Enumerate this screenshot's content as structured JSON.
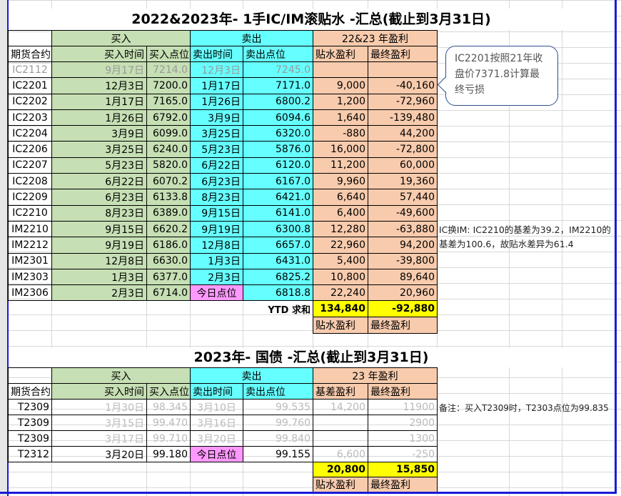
{
  "table1": {
    "title": "2022&2023年- 1手IC/IM滚贴水 -汇总(截止到3月31日)",
    "group_buy": "买入",
    "group_sell": "卖出",
    "group_profit": "22&23 年盈利",
    "headers": [
      "期货合约",
      "买入时间",
      "买入点位",
      "卖出时间",
      "卖出点位",
      "贴水盈利",
      "最终盈利"
    ],
    "rows": [
      {
        "c": "IC2112",
        "bt": "9月17日",
        "bp": "7214.0",
        "st": "12月3日",
        "sp": "7245.0",
        "dp": "",
        "fp": "",
        "gray": true
      },
      {
        "c": "IC2201",
        "bt": "12月3日",
        "bp": "7200.0",
        "st": "1月17日",
        "sp": "7171.0",
        "dp": "9,000",
        "fp": "-40,160"
      },
      {
        "c": "IC2202",
        "bt": "1月17日",
        "bp": "7165.0",
        "st": "1月26日",
        "sp": "6800.2",
        "dp": "1,200",
        "fp": "-72,960"
      },
      {
        "c": "IC2203",
        "bt": "1月26日",
        "bp": "6792.0",
        "st": "3月9日",
        "sp": "6094.6",
        "dp": "1,640",
        "fp": "-139,480"
      },
      {
        "c": "IC2204",
        "bt": "3月9日",
        "bp": "6099.0",
        "st": "3月25日",
        "sp": "6320.0",
        "dp": "-880",
        "fp": "44,200"
      },
      {
        "c": "IC2206",
        "bt": "3月25日",
        "bp": "6240.0",
        "st": "5月23日",
        "sp": "5876.0",
        "dp": "16,000",
        "fp": "-72,800"
      },
      {
        "c": "IC2207",
        "bt": "5月23日",
        "bp": "5820.0",
        "st": "6月22日",
        "sp": "6120.0",
        "dp": "11,200",
        "fp": "60,000"
      },
      {
        "c": "IC2208",
        "bt": "6月22日",
        "bp": "6070.2",
        "st": "6月23日",
        "sp": "6167.0",
        "dp": "9,960",
        "fp": "19,360"
      },
      {
        "c": "IC2209",
        "bt": "6月23日",
        "bp": "6133.8",
        "st": "8月23日",
        "sp": "6421.0",
        "dp": "6,640",
        "fp": "57,440"
      },
      {
        "c": "IC2210",
        "bt": "8月23日",
        "bp": "6389.0",
        "st": "9月15日",
        "sp": "6141.0",
        "dp": "6,400",
        "fp": "-49,600"
      },
      {
        "c": "IM2210",
        "bt": "9月15日",
        "bp": "6620.2",
        "st": "9月19日",
        "sp": "6300.8",
        "dp": "12,280",
        "fp": "-63,880"
      },
      {
        "c": "IM2212",
        "bt": "9月19日",
        "bp": "6186.0",
        "st": "12月8日",
        "sp": "6657.0",
        "dp": "22,960",
        "fp": "94,200"
      },
      {
        "c": "IM2301",
        "bt": "12月8日",
        "bp": "6630.0",
        "st": "1月3日",
        "sp": "6431.0",
        "dp": "5,400",
        "fp": "-39,800"
      },
      {
        "c": "IM2303",
        "bt": "1月3日",
        "bp": "6377.0",
        "st": "2月3日",
        "sp": "6825.2",
        "dp": "10,800",
        "fp": "89,640"
      },
      {
        "c": "IM2306",
        "bt": "2月3日",
        "bp": "6714.0",
        "st": "今日点位",
        "sp": "6818.8",
        "dp": "22,240",
        "fp": "20,960",
        "today": true
      }
    ],
    "ytd_label": "YTD 求和",
    "total_dp": "134,840",
    "total_fp": "-92,880",
    "footer": [
      "贴水盈利",
      "最终盈利"
    ]
  },
  "table2": {
    "title": "2023年- 国债 -汇总(截止到3月31日)",
    "group_buy": "买入",
    "group_sell": "卖出",
    "group_profit": "23 年盈利",
    "headers": [
      "期货合约",
      "买入时间",
      "买入点位",
      "卖出时间",
      "卖出点位",
      "基差盈利",
      "最终盈利"
    ],
    "rows": [
      {
        "c": "T2309",
        "bt": "1月30日",
        "bp": "98.345",
        "st": "3月10日",
        "sp": "99.535",
        "dp": "14,200",
        "fp": "11900",
        "gray": true
      },
      {
        "c": "T2309",
        "bt": "3月15日",
        "bp": "99.470",
        "st": "3月16日",
        "sp": "99.760",
        "dp": "",
        "fp": "2900",
        "gray": true
      },
      {
        "c": "T2309",
        "bt": "3月17日",
        "bp": "99.710",
        "st": "3月20日",
        "sp": "99.840",
        "dp": "",
        "fp": "1300",
        "gray": true
      },
      {
        "c": "T2312",
        "bt": "3月20日",
        "bp": "99.180",
        "st": "今日点位",
        "sp": "99.155",
        "dp": "6,600",
        "fp": "-250",
        "today": true
      }
    ],
    "total_dp": "20,800",
    "total_fp": "15,850",
    "footer": [
      "贴水盈利",
      "最终盈利"
    ]
  },
  "callout": "IC2201按照21年收盘价7371.8计算最终亏损",
  "note1": "IC换IM: IC2210的基差为39.2，IM2210的基差为100.6，故贴水差异为61.4",
  "note2": "备注：买入T2309时，T2303点位为99.835"
}
